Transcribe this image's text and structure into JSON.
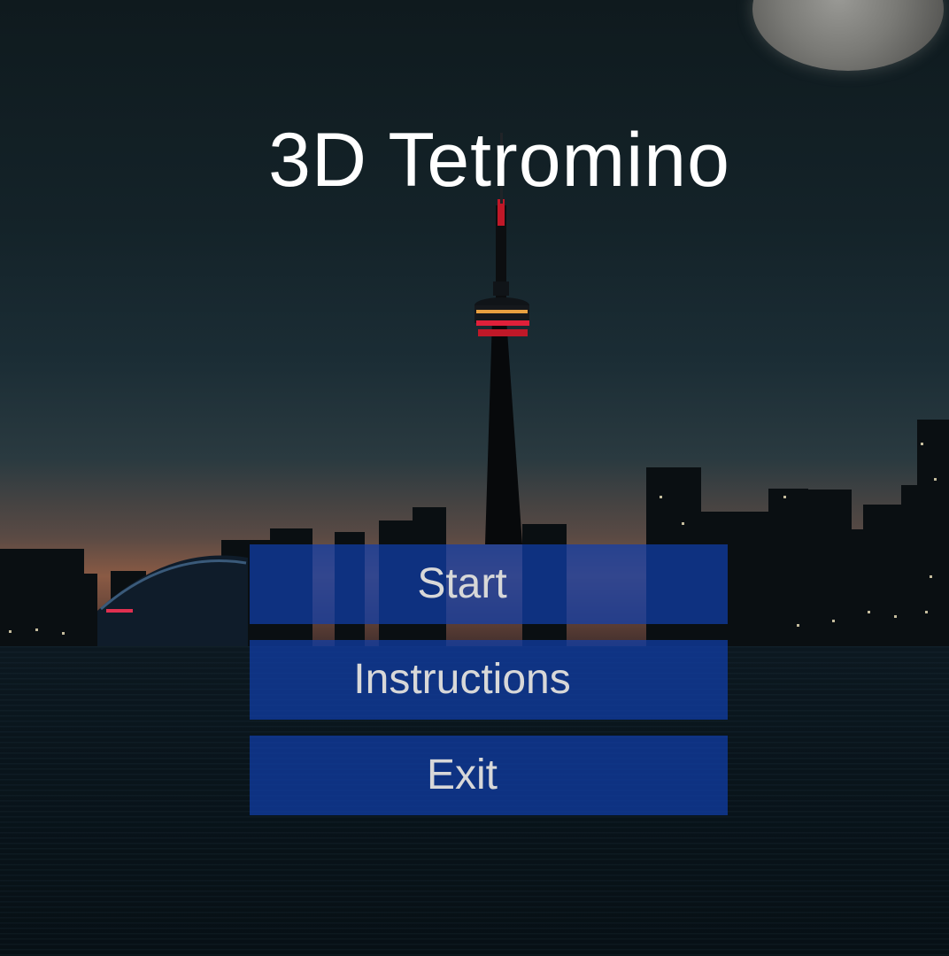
{
  "game": {
    "title": "3D Tetromino"
  },
  "menu": {
    "start_label": "Start",
    "instructions_label": "Instructions",
    "exit_label": "Exit"
  },
  "colors": {
    "button_fill": "#103EAA",
    "title_text": "#FFFFFF",
    "button_text": "#D8D8D8",
    "tower_light": "#E0203A"
  }
}
